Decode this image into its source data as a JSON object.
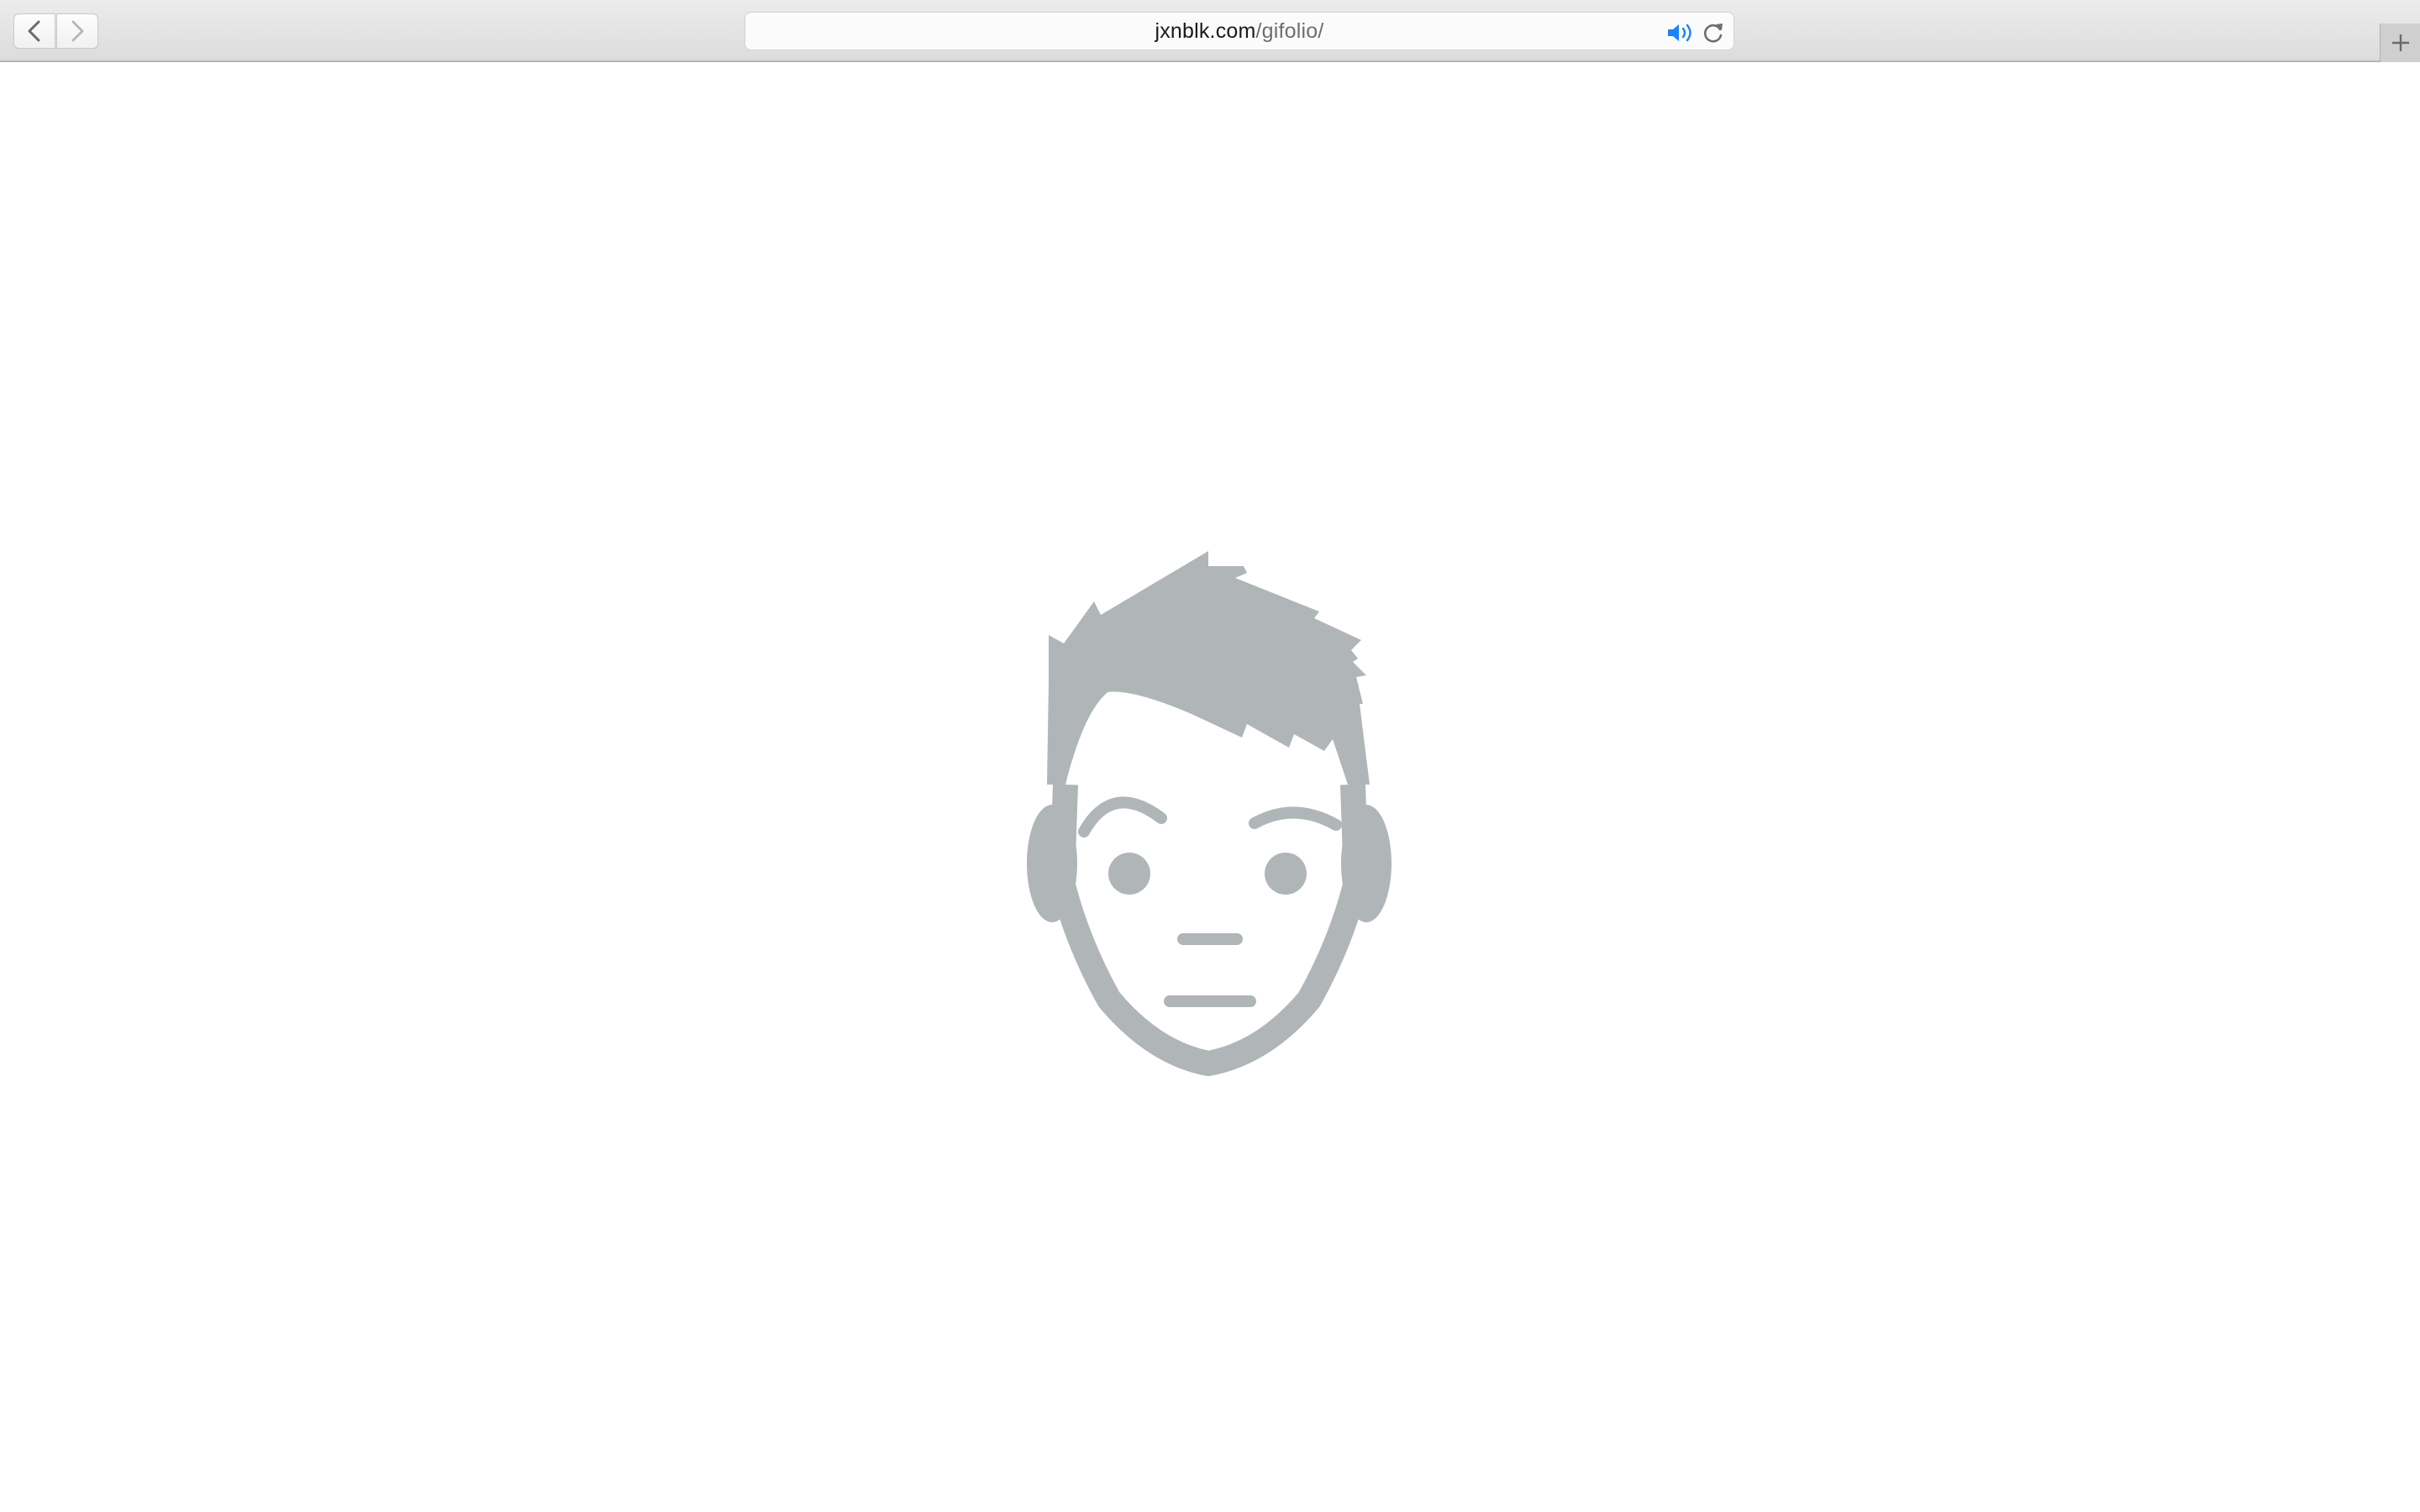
{
  "browser": {
    "url_domain": "jxnblk.com",
    "url_path": "/gifolio/",
    "icons": {
      "back": "chevron-left-icon",
      "forward": "chevron-right-icon",
      "audio": "speaker-icon",
      "reload": "reload-icon",
      "new_tab": "plus-icon"
    },
    "accent_color": "#1a82fb"
  },
  "page": {
    "illustration": "avatar-face-icon",
    "illustration_color": "#b0b5b8"
  }
}
